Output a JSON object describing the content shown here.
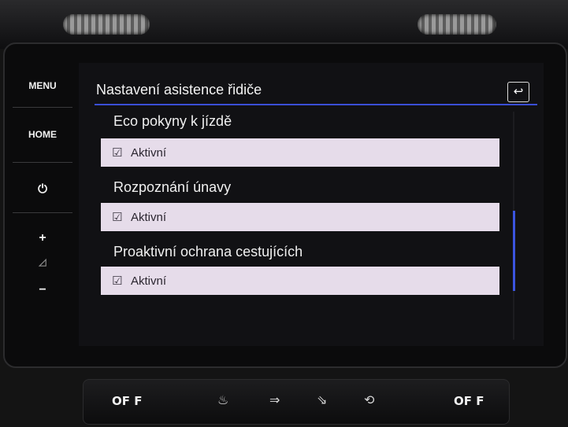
{
  "side_menu": {
    "menu": "MENU",
    "home": "HOME",
    "power": "⏻",
    "vol_plus": "+",
    "vol_icon": "◿",
    "vol_minus": "−"
  },
  "header": {
    "title": "Nastavení asistence řidiče",
    "back_icon": "↩"
  },
  "items": [
    {
      "title": "Eco pokyny k jízdě",
      "option": "Aktivní",
      "checked": true
    },
    {
      "title": "Rozpoznání únavy",
      "option": "Aktivní",
      "checked": true
    },
    {
      "title": "Proaktivní ochrana cestujících",
      "option": "Aktivní",
      "checked": true
    }
  ],
  "climate": {
    "left": "OF F",
    "right": "OF F",
    "icons": [
      "seat-heat-icon",
      "fan-face-icon",
      "fan-feet-icon",
      "recirculation-icon"
    ]
  },
  "colors": {
    "accent": "#3a4fd6",
    "row_bg": "#e6dcea"
  }
}
